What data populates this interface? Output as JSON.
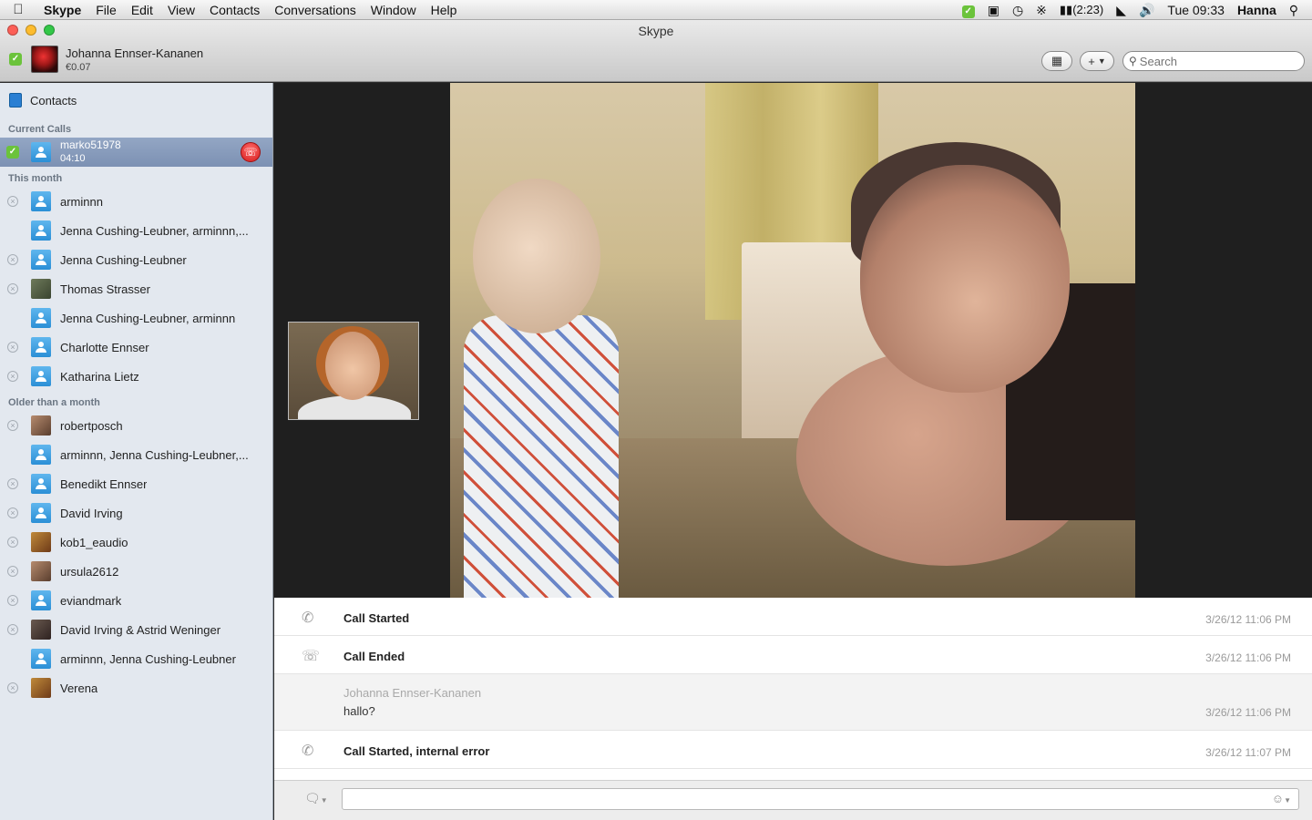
{
  "menubar": {
    "apple": "",
    "items": [
      "Skype",
      "File",
      "Edit",
      "View",
      "Contacts",
      "Conversations",
      "Window",
      "Help"
    ],
    "status": {
      "battery": "(2:23)",
      "clock": "Tue 09:33",
      "user": "Hanna"
    },
    "icons": [
      "skype-status-icon",
      "display-icon",
      "time-machine-icon",
      "bluetooth-icon",
      "battery-icon",
      "wifi-icon",
      "volume-icon",
      "spotlight-icon"
    ]
  },
  "window": {
    "title": "Skype",
    "me": {
      "name": "Johanna Ennser-Kananen",
      "credit": "€0.07"
    },
    "search_placeholder": "Search"
  },
  "sidebar": {
    "contacts_label": "Contacts",
    "current_calls_header": "Current Calls",
    "current_call": {
      "name": "marko51978",
      "duration": "04:10"
    },
    "this_month_header": "This month",
    "this_month": [
      {
        "name": "arminnn",
        "avatar": "person",
        "status": "offline"
      },
      {
        "name": "Jenna Cushing-Leubner, arminnn,...",
        "avatar": "group",
        "status": "none"
      },
      {
        "name": "Jenna Cushing-Leubner",
        "avatar": "person",
        "status": "offline"
      },
      {
        "name": "Thomas Strasser",
        "avatar": "photo",
        "status": "offline"
      },
      {
        "name": "Jenna Cushing-Leubner, arminnn",
        "avatar": "group",
        "status": "none"
      },
      {
        "name": "Charlotte Ennser",
        "avatar": "person",
        "status": "offline"
      },
      {
        "name": "Katharina Lietz",
        "avatar": "person",
        "status": "offline"
      }
    ],
    "older_header": "Older than a month",
    "older": [
      {
        "name": "robertposch",
        "avatar": "photo",
        "status": "offline"
      },
      {
        "name": "arminnn, Jenna Cushing-Leubner,...",
        "avatar": "group",
        "status": "none"
      },
      {
        "name": "Benedikt Ennser",
        "avatar": "person",
        "status": "offline"
      },
      {
        "name": "David Irving",
        "avatar": "person",
        "status": "offline"
      },
      {
        "name": "kob1_eaudio",
        "avatar": "photo",
        "status": "offline"
      },
      {
        "name": "ursula2612",
        "avatar": "photo",
        "status": "offline"
      },
      {
        "name": "eviandmark",
        "avatar": "person",
        "status": "offline"
      },
      {
        "name": "David Irving & Astrid Weninger",
        "avatar": "photo",
        "status": "offline"
      },
      {
        "name": "arminnn, Jenna Cushing-Leubner",
        "avatar": "group",
        "status": "none"
      },
      {
        "name": "Verena",
        "avatar": "photo",
        "status": "offline"
      }
    ]
  },
  "log": [
    {
      "type": "call",
      "title": "Call Started",
      "time": "3/26/12 11:06 PM"
    },
    {
      "type": "end",
      "title": "Call Ended",
      "time": "3/26/12 11:06 PM"
    },
    {
      "type": "message",
      "author": "Johanna Ennser-Kananen",
      "message": "hallo?",
      "time": "3/26/12 11:06 PM"
    },
    {
      "type": "call",
      "title": "Call Started, internal error",
      "time": "3/26/12 11:07 PM"
    }
  ],
  "colors": {
    "sidebar_bg": "#e3e8ef",
    "selected_row": "#7c91b3",
    "hangup_red": "#d51d1d",
    "online_green": "#6bc33b"
  }
}
